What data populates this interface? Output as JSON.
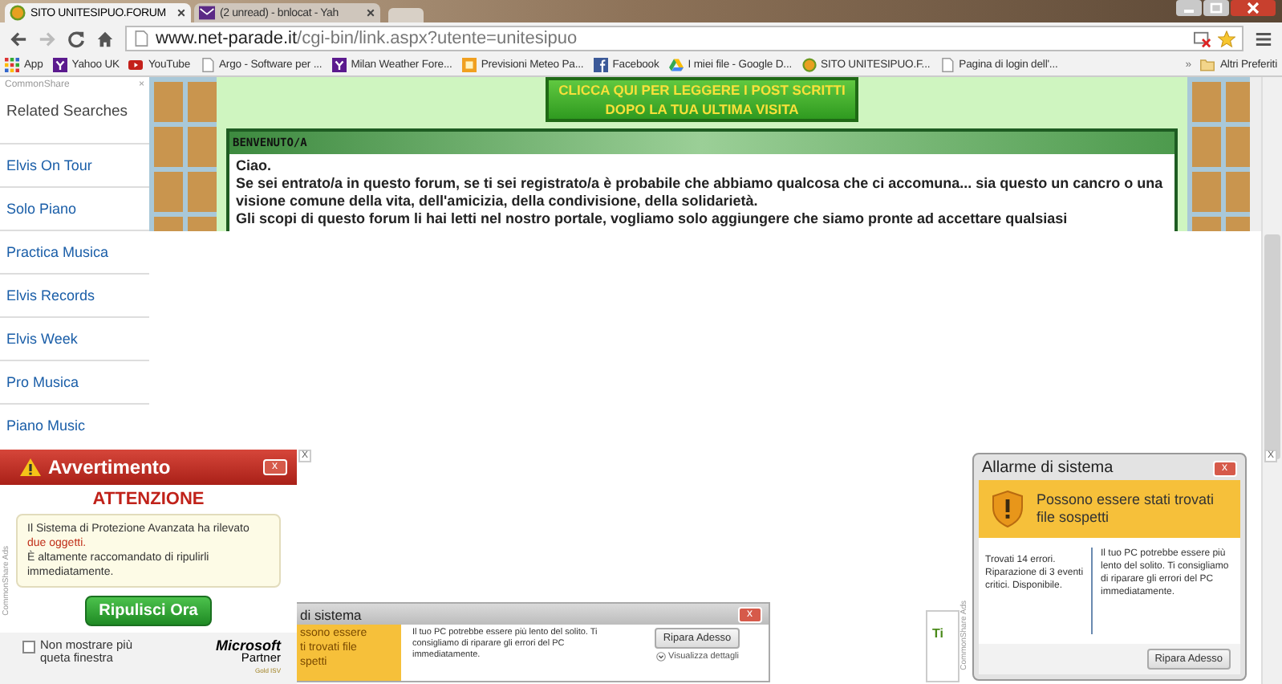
{
  "browser": {
    "tabs": [
      {
        "title": "SITO UNITESIPUO.FORUM",
        "kind": "forum",
        "selected": true
      },
      {
        "title": "(2 unread) - bnlocat - Yah",
        "kind": "mail",
        "selected": false
      }
    ],
    "url": {
      "host": "www.net-parade.it",
      "path": "/cgi-bin/link.aspx?utente=unitesipuo"
    },
    "bookmarks": [
      {
        "label": "App",
        "kind": "apps"
      },
      {
        "label": "Yahoo UK",
        "kind": "yahoo"
      },
      {
        "label": "YouTube",
        "kind": "youtube"
      },
      {
        "label": "Argo - Software per ...",
        "kind": "page"
      },
      {
        "label": "Milan Weather Fore...",
        "kind": "yahoo"
      },
      {
        "label": "Previsioni Meteo Pa...",
        "kind": "meteo"
      },
      {
        "label": "Facebook",
        "kind": "facebook"
      },
      {
        "label": "I miei file - Google D...",
        "kind": "drive"
      },
      {
        "label": "SITO UNITESIPUO.F...",
        "kind": "forum"
      },
      {
        "label": "Pagina di login dell'...",
        "kind": "page"
      }
    ],
    "overflow": "»",
    "folder": "Altri Preferiti"
  },
  "sidebar": {
    "provider": "CommonShare",
    "close": "×",
    "heading": "Related Searches",
    "links": [
      "Elvis On Tour",
      "Solo Piano",
      "Practica Musica",
      "Elvis Records",
      "Elvis Week",
      "Pro Musica",
      "Piano Music"
    ]
  },
  "forum": {
    "banner": [
      "CLICCA QUI PER LEGGERE I POST SCRITTI",
      "DOPO LA TUA ULTIMA VISITA"
    ],
    "box_title": "BENVENUTO/A",
    "paragraphs": [
      "Ciao.",
      "Se sei entrato/a in questo forum, se ti sei registrato/a è probabile che abbiamo qualcosa che ci accomuna... sia questo un cancro o una visione comune della vita, dell'amicizia, della condivisione, della solidarietà.",
      "Gli scopi di questo forum li hai letti nel nostro portale, vogliamo solo aggiungere che siamo pronte ad accettare qualsiasi"
    ]
  },
  "ads": {
    "warning": {
      "title": "Avvertimento",
      "close": "x",
      "heading": "ATTENZIONE",
      "message": [
        {
          "kind": "plain",
          "text": "Il Sistema di Protezione Avanzata ha rilevato "
        },
        {
          "kind": "alert",
          "text": "due oggetti."
        },
        {
          "kind": "plain",
          "text": "\nÈ altamente raccomandato di ripulirli immediatamente."
        }
      ],
      "button": "Ripulisci Ora",
      "checkbox": {
        "label": "Non mostrare più queta finestra",
        "checked": false
      },
      "partner": [
        "Microsoft",
        "Partner",
        "Gold ISV"
      ]
    },
    "small_alert": {
      "title": "di sistema",
      "close": "x",
      "headline": [
        "ssono essere",
        "ti trovati file",
        "spetti"
      ],
      "body": "Il tuo PC potrebbe essere più lento del solito. Ti consigliamo di riparare gli errori del PC immediatamente.",
      "button": "Ripara Adesso",
      "details": "Visualizza dettagli"
    },
    "teaser": "Ti",
    "system_alert": {
      "title": "Allarme di sistema",
      "close": "x",
      "headline": "Possono essere stati trovati file sospetti",
      "left": "Trovati 14 errori. Riparazione di 3 eventi critici. Disponibile.",
      "right": "Il tuo PC potrebbe essere più lento del solito. Ti consigliamo di riparare gli errori del PC immediatamente.",
      "button": "Ripara Adesso"
    },
    "labels": [
      "CommonShare Ads",
      "CommonShare Ads"
    ],
    "close_marks": [
      "X",
      "X"
    ]
  }
}
